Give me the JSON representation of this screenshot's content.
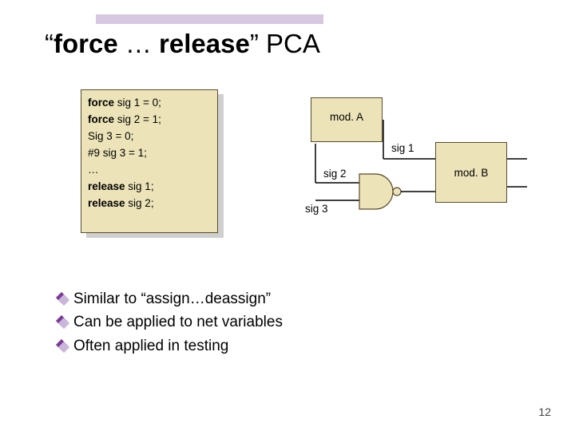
{
  "title": {
    "open_quote": "“",
    "word1": "force",
    "ellipsis": " … ",
    "word2": "release",
    "close_quote": "”",
    "tail": " PCA"
  },
  "code": {
    "l1a": "force ",
    "l1b": "sig 1 = 0;",
    "l2a": "force ",
    "l2b": "sig 2 = 1;",
    "l3": "Sig 3 = 0;",
    "l4": "#9 sig 3 = 1;",
    "l5": "…",
    "l6a": "release ",
    "l6b": "sig 1;",
    "l7a": "release ",
    "l7b": "sig 2;"
  },
  "diagram": {
    "modA": "mod. A",
    "modB": "mod. B",
    "sig1": "sig 1",
    "sig2": "sig 2",
    "sig3": "sig 3"
  },
  "bullets": {
    "b1": "Similar to “assign…deassign”",
    "b2": "Can be applied to net variables",
    "b3": "Often applied in testing"
  },
  "page": "12",
  "colors": {
    "box_fill": "#ece4b8",
    "box_border": "#5a4a2a",
    "topbar": "#d8c7e0",
    "bullet_dark": "#7b3a99",
    "bullet_light": "#c9b6d8"
  }
}
